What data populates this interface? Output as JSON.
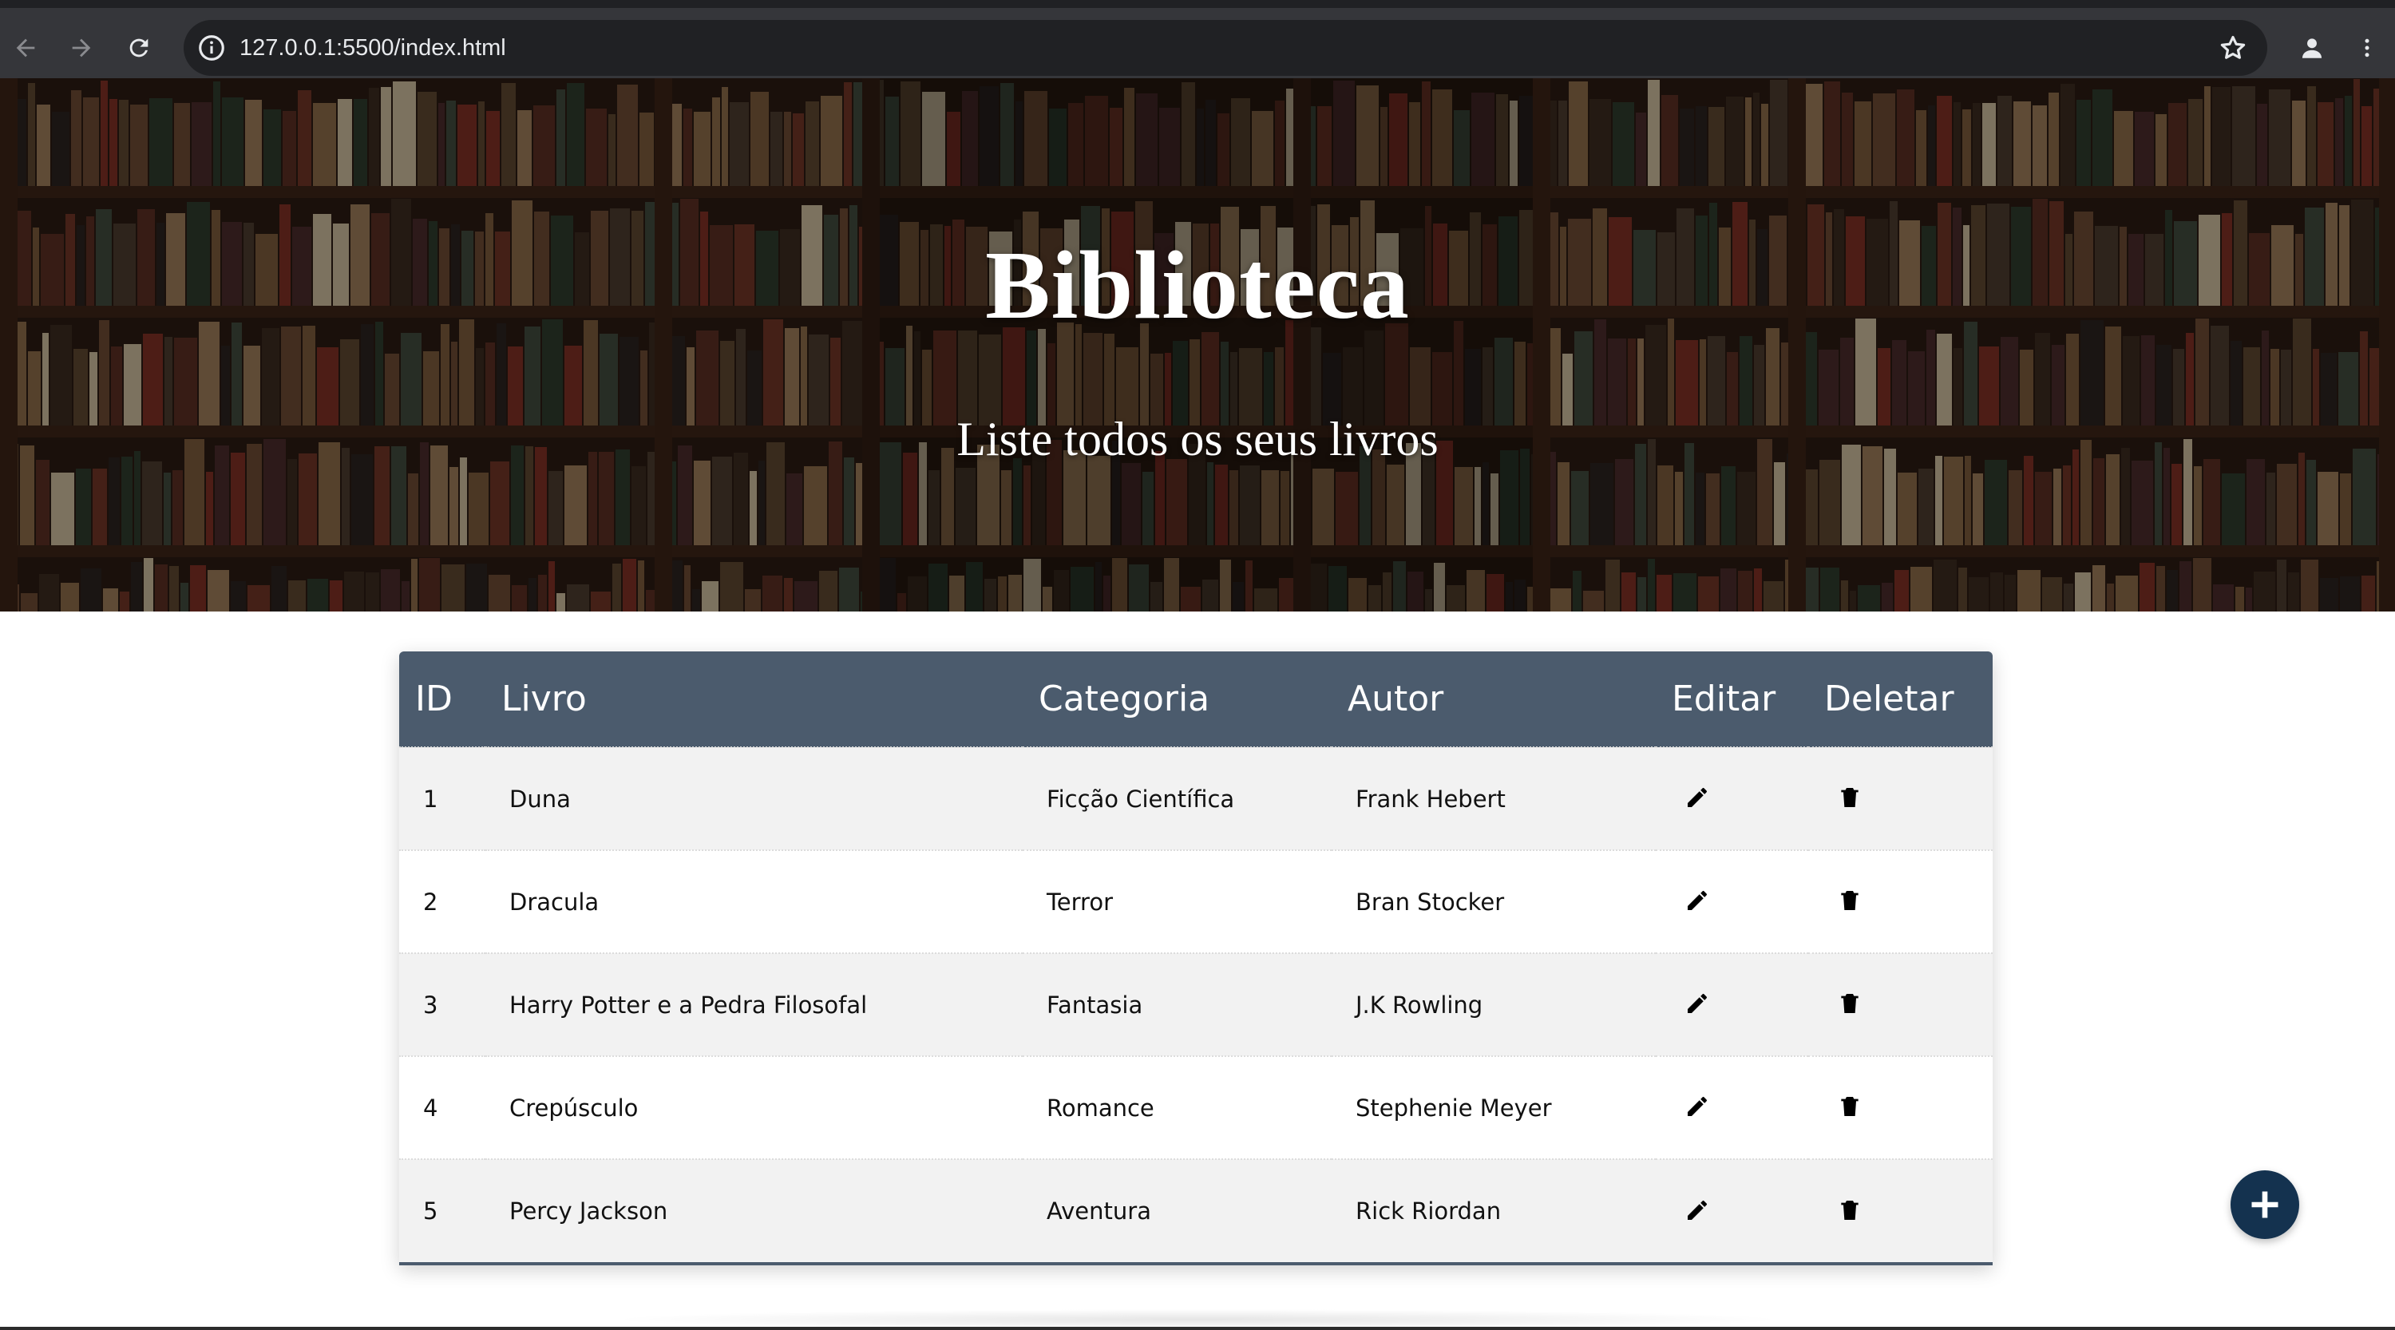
{
  "browser": {
    "url": "127.0.0.1:5500/index.html",
    "icons": [
      "back-arrow-icon",
      "forward-arrow-icon",
      "reload-icon",
      "site-info-icon",
      "bookmark-star-icon",
      "profile-icon",
      "menu-dots-icon"
    ]
  },
  "hero": {
    "title": "Biblioteca",
    "subtitle": "Liste todos os seus livros"
  },
  "table": {
    "headers": {
      "id": "ID",
      "livro": "Livro",
      "categoria": "Categoria",
      "autor": "Autor",
      "editar": "Editar",
      "deletar": "Deletar"
    },
    "rows": [
      {
        "id": "1",
        "livro": "Duna",
        "categoria": "Ficção Científica",
        "autor": "Frank Hebert"
      },
      {
        "id": "2",
        "livro": "Dracula",
        "categoria": "Terror",
        "autor": "Bran Stocker"
      },
      {
        "id": "3",
        "livro": "Harry Potter e a Pedra Filosofal",
        "categoria": "Fantasia",
        "autor": "J.K Rowling"
      },
      {
        "id": "4",
        "livro": "Crepúsculo",
        "categoria": "Romance",
        "autor": "Stephenie Meyer"
      },
      {
        "id": "5",
        "livro": "Percy Jackson",
        "categoria": "Aventura",
        "autor": "Rick Riordan"
      }
    ],
    "row_icons": {
      "edit": "pencil-icon",
      "delete": "trash-icon"
    }
  },
  "fab": {
    "icon": "plus-icon"
  },
  "colors": {
    "header_bg": "#4b5b6d",
    "fab_bg": "#14324f",
    "row_alt": "#f2f2f2",
    "chrome_bg": "#35363a"
  }
}
